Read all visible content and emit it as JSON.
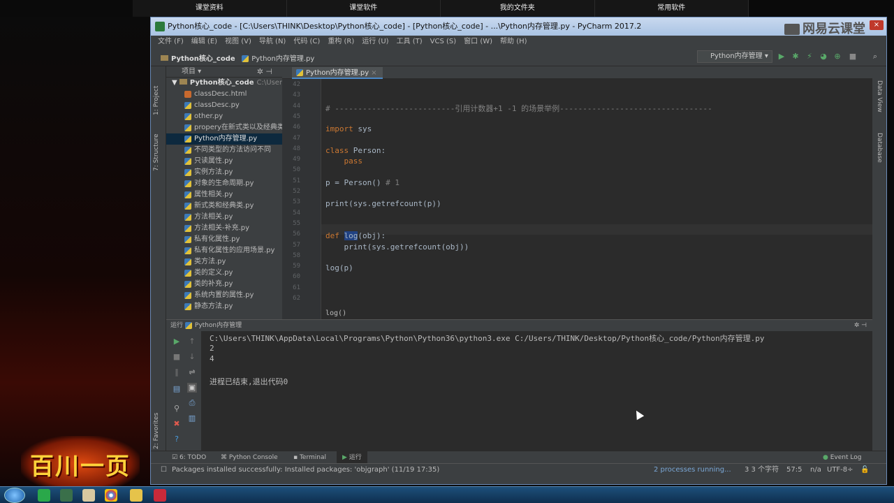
{
  "top_tabs": [
    "课堂资料",
    "课堂软件",
    "我的文件夹",
    "常用软件"
  ],
  "window": {
    "title": "Python核心_code - [C:\\Users\\THINK\\Desktop\\Python核心_code] - [Python核心_code] - ...\\Python内存管理.py - PyCharm 2017.2",
    "watermark": "网易云课堂",
    "close": "×"
  },
  "menu": [
    "文件 (F)",
    "编辑 (E)",
    "视图 (V)",
    "导航 (N)",
    "代码 (C)",
    "重构 (R)",
    "运行 (U)",
    "工具 (T)",
    "VCS (S)",
    "窗口 (W)",
    "帮助 (H)"
  ],
  "nav": {
    "project": "Python核心_code",
    "file": "Python内存管理.py",
    "run_config": "Python内存管理"
  },
  "left_strip": {
    "project_tab": "1: Project",
    "structure_tab": "7: Structure",
    "favorites_tab": "2: Favorites"
  },
  "right_strip": {
    "data_view": "Data View",
    "database": "Database"
  },
  "project_panel": {
    "header": "项目",
    "root": "Python核心_code",
    "root_path": "C:\\Users",
    "files": [
      {
        "name": "classDesc.html",
        "type": "html"
      },
      {
        "name": "classDesc.py",
        "type": "py"
      },
      {
        "name": "other.py",
        "type": "py"
      },
      {
        "name": "propery在新式类以及经典类",
        "type": "py"
      },
      {
        "name": "Python内存管理.py",
        "type": "py",
        "selected": true
      },
      {
        "name": "不同类型的方法访问不同",
        "type": "py"
      },
      {
        "name": "只读属性.py",
        "type": "py"
      },
      {
        "name": "实例方法.py",
        "type": "py"
      },
      {
        "name": "对象的生命周期.py",
        "type": "py"
      },
      {
        "name": "属性相关.py",
        "type": "py"
      },
      {
        "name": "新式类和经典类.py",
        "type": "py"
      },
      {
        "name": "方法相关.py",
        "type": "py"
      },
      {
        "name": "方法相关-补充.py",
        "type": "py"
      },
      {
        "name": "私有化属性.py",
        "type": "py"
      },
      {
        "name": "私有化属性的应用场景.py",
        "type": "py"
      },
      {
        "name": "类方法.py",
        "type": "py"
      },
      {
        "name": "类的定义.py",
        "type": "py"
      },
      {
        "name": "类的补充.py",
        "type": "py"
      },
      {
        "name": "系统内置的属性.py",
        "type": "py"
      },
      {
        "name": "静态方法.py",
        "type": "py"
      }
    ]
  },
  "editor": {
    "tab": "Python内存管理.py",
    "line_numbers": [
      "42",
      "43",
      "44",
      "45",
      "46",
      "47",
      "48",
      "49",
      "50",
      "51",
      "52",
      "53",
      "54",
      "55",
      "56",
      "57",
      "58",
      "59",
      "60",
      "61",
      "62"
    ],
    "comment_line": "# --------------------------引用计数器+1 -1 的场景举例---------------------------------",
    "import_kw": "import",
    "import_mod": " sys",
    "class_kw": "class",
    "class_name": " Person:",
    "pass_kw": "    pass",
    "assign": "p = Person()",
    "assign_comment": " # 1",
    "print1": "print(sys.getrefcount(p))",
    "def_kw": "def ",
    "def_name": "log",
    "def_rest": "(obj):",
    "print2": "    print(sys.getrefcount(obj))",
    "call_fn": "log",
    "call_rest": "(p)",
    "breadcrumb": "log()"
  },
  "run_panel": {
    "header": "运行",
    "config": "Python内存管理",
    "output": [
      "C:\\Users\\THINK\\AppData\\Local\\Programs\\Python\\Python36\\python3.exe C:/Users/THINK/Desktop/Python核心_code/Python内存管理.py",
      "2",
      "4",
      "",
      "进程已结束,退出代码0"
    ]
  },
  "bottom_tabs": {
    "todo": "6: TODO",
    "console": "Python Console",
    "terminal": "Terminal",
    "run": "运行",
    "event_log": "Event Log"
  },
  "status": {
    "message": "Packages installed successfully: Installed packages: 'objgraph' (11/19 17:35)",
    "processes": "2 processes running...",
    "chars": "3 3 个字符",
    "position": "57:5",
    "na": "n/a",
    "encoding": "UTF-8÷"
  },
  "logo_text": "百川一页"
}
